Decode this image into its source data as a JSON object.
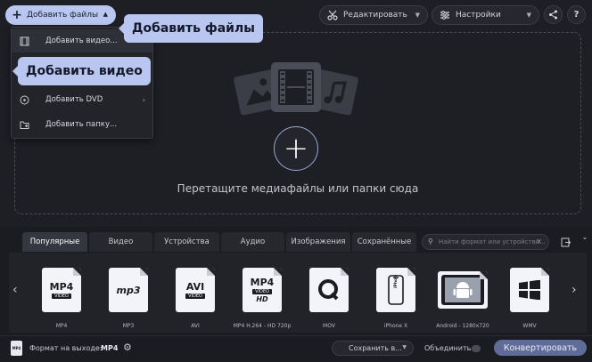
{
  "toolbar": {
    "add_files_label": "Добавить файлы",
    "edit_label": "Редактировать",
    "settings_label": "Настройки"
  },
  "menu": {
    "items": [
      {
        "label": "Добавить видео...",
        "icon": "video-icon"
      },
      {
        "label": "Добавить DVD",
        "icon": "dvd-icon",
        "has_submenu": true
      },
      {
        "label": "Добавить папку...",
        "icon": "folder-icon"
      }
    ]
  },
  "callouts": {
    "add_files": "Добавить файлы",
    "add_video": "Добавить видео"
  },
  "drop_area": {
    "hint": "Перетащите медиафайлы или папки сюда"
  },
  "tabs": [
    {
      "label": "Популярные",
      "active": true
    },
    {
      "label": "Видео"
    },
    {
      "label": "Устройства"
    },
    {
      "label": "Аудио"
    },
    {
      "label": "Изображения"
    },
    {
      "label": "Сохранённые"
    }
  ],
  "search": {
    "placeholder": "Найти формат или устройство..."
  },
  "formats": [
    {
      "name": "MP4",
      "caption": "MP4"
    },
    {
      "name": "mp3",
      "caption": "MP3"
    },
    {
      "name": "AVI",
      "caption": "AVI"
    },
    {
      "name": "MP4",
      "extra": "HD",
      "caption": "MP4 H.264 - HD 720p"
    },
    {
      "name": "MOV",
      "caption": "MOV"
    },
    {
      "name": "iPhone",
      "caption": "iPhone X"
    },
    {
      "name": "Android",
      "caption": "Android - 1280x720"
    },
    {
      "name": "WMV",
      "caption": "WMV"
    }
  ],
  "statusbar": {
    "output_format_label": "Формат на выходе:",
    "output_format_value": "MP4",
    "save_label": "Сохранить в...",
    "merge_label": "Объединить:",
    "convert_label": "Конвертировать"
  },
  "colors": {
    "accent": "#b8c6f0",
    "background": "#1e1f24",
    "convert_button": "#5f6c99"
  }
}
